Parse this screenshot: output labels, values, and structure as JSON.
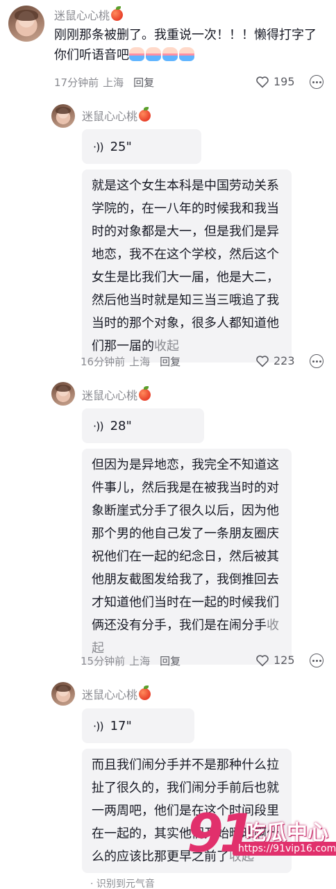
{
  "comments": [
    {
      "username": "迷鼠心心桃",
      "text": "刚刚那条被删了。我重说一次！！！懒得打字了你们听语音吧",
      "emoji_count": 4,
      "time": "17分钟前",
      "location": "上海",
      "reply": "回复",
      "likes": "195"
    }
  ],
  "replies": [
    {
      "username": "迷鼠心心桃",
      "voice_duration": "25\"",
      "transcript": "就是这个女生本科是中国劳动关系学院的，在一八年的时候我和我当时的对象都是大一，但是我们是异地恋，我不在这个学校，然后这个女生是比我们大一届，他是大二，然后他当时就是知三当三哦追了我当时的那个对象，很多人都知道他们那一届的",
      "collapse": "收起",
      "time": "16分钟前",
      "location": "上海",
      "reply": "回复",
      "likes": "223"
    },
    {
      "username": "迷鼠心心桃",
      "voice_duration": "28\"",
      "transcript": "但因为是异地恋，我完全不知道这件事儿，然后我是在被我当时的对象断崖式分手了很久以后，因为他那个男的他自己发了一条朋友圈庆祝他们在一起的纪念日，然后被其他朋友截图发给我了，我倒推回去才知道他们当时在一起的时候我们俩还没有分手，我们是在闹分手",
      "collapse": "收起",
      "time": "15分钟前",
      "location": "上海",
      "reply": "回复",
      "likes": "125"
    },
    {
      "username": "迷鼠心心桃",
      "voice_duration": "17\"",
      "transcript": "而且我们闹分手并不是那种什么拉扯了很久的，我们闹分手前后也就一两周吧，他们是在这个时间段里在一起的，其实他们开始暧昧啊什么的应该比那更早之前了",
      "collapse": "收起",
      "footer_note": "· 识别到元气音"
    }
  ],
  "watermark": {
    "number": "91",
    "title": "吃瓜中心",
    "url": "https://91vip16.com"
  },
  "icons": {
    "like": "heart-outline-icon",
    "more": "more-options-icon",
    "voice": "sound-wave-icon",
    "badge": "peach-icon"
  },
  "colors": {
    "text": "#161823",
    "muted": "#8a8b91",
    "bubble": "#f3f3f5",
    "watermark": "#e1306c"
  }
}
